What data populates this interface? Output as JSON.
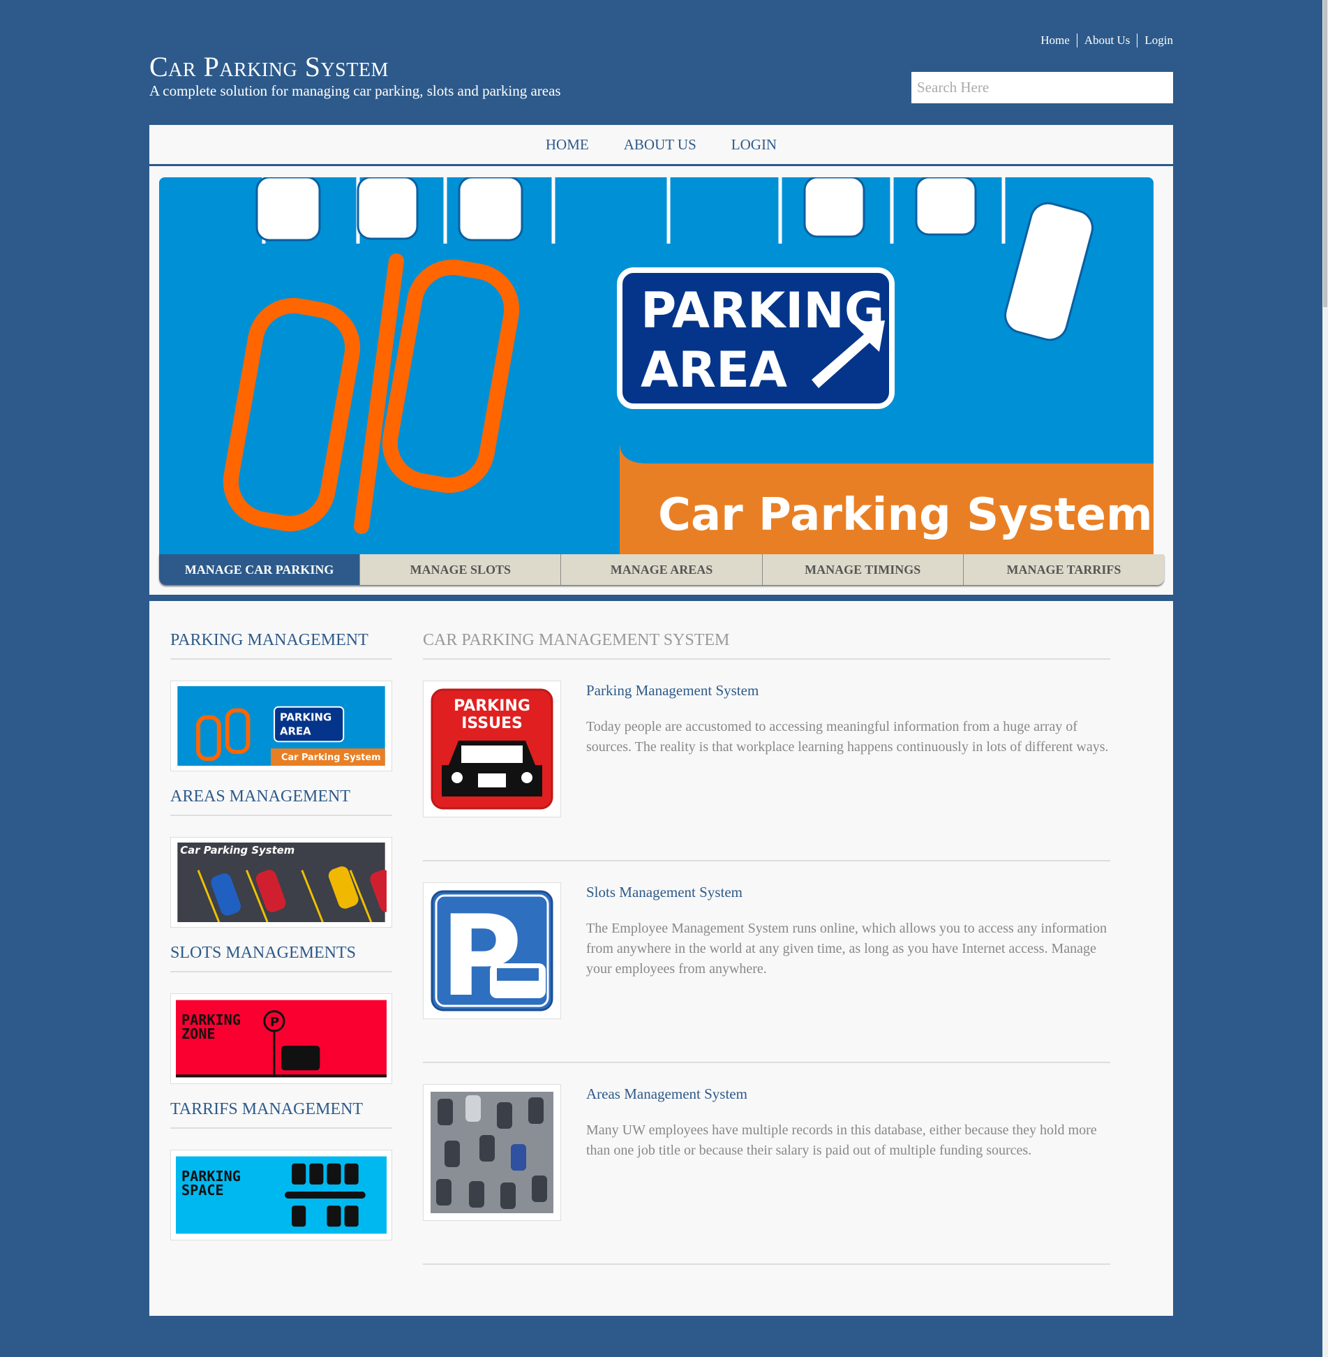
{
  "top_links": [
    "Home",
    "About Us",
    "Login"
  ],
  "site": {
    "title": "Car Parking System",
    "subtitle": "A complete solution for managing car parking, slots and parking areas"
  },
  "search": {
    "placeholder": "Search Here",
    "value": ""
  },
  "nav": [
    "HOME",
    "ABOUT US",
    "LOGIN"
  ],
  "banner": {
    "sign_line1": "PARKING",
    "sign_line2": "AREA",
    "caption": "Car Parking System"
  },
  "tabs": [
    "MANAGE CAR PARKING",
    "MANAGE SLOTS",
    "MANAGE AREAS",
    "MANAGE TIMINGS",
    "MANAGE TARRIFS"
  ],
  "active_tab": 0,
  "sidebar": [
    {
      "heading": "PARKING MANAGEMENT",
      "image_text": [
        "PARKING",
        "AREA",
        "Car Parking System"
      ]
    },
    {
      "heading": "AREAS MANAGEMENT",
      "image_text": [
        "Car Parking System"
      ]
    },
    {
      "heading": "SLOTS MANAGEMENTS",
      "image_text": [
        "PARKING",
        "ZONE",
        "P"
      ]
    },
    {
      "heading": "TARRIFS MANAGEMENT",
      "image_text": [
        "PARKING",
        "SPACE"
      ]
    }
  ],
  "content": {
    "heading": "CAR PARKING MANAGEMENT SYSTEM",
    "articles": [
      {
        "title": "Parking Management System",
        "text": "Today people are accustomed to accessing meaningful information from a huge array of sources. The reality is that workplace learning happens continuously in lots of different ways.",
        "image_text": [
          "PARKING",
          "ISSUES"
        ]
      },
      {
        "title": "Slots Management System",
        "text": "The Employee Management System runs online, which allows you to access any information from anywhere in the world at any given time, as long as you have Internet access. Manage your employees from anywhere.",
        "image_text": [
          "P"
        ]
      },
      {
        "title": "Areas Management System",
        "text": "Many UW employees have multiple records in this database, either because they hold more than one job title or because their salary is paid out of multiple funding sources."
      }
    ]
  },
  "colors": {
    "brand": "#2d5a8a",
    "banner_blue": "#0090d6",
    "banner_orange": "#e97f24",
    "tab_bg": "#dedacb"
  }
}
